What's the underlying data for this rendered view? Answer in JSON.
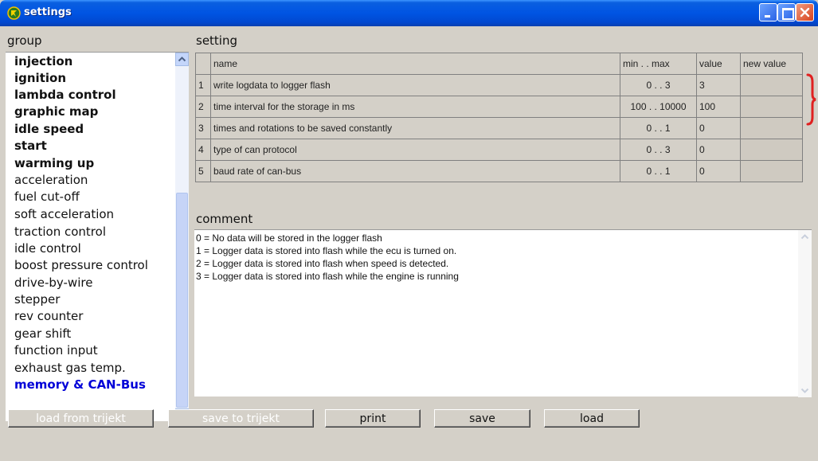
{
  "window": {
    "title": "settings"
  },
  "group": {
    "label": "group",
    "items": [
      {
        "label": "injection",
        "bold": true
      },
      {
        "label": "ignition",
        "bold": true
      },
      {
        "label": "lambda control",
        "bold": true
      },
      {
        "label": "graphic map",
        "bold": true
      },
      {
        "label": "idle speed",
        "bold": true
      },
      {
        "label": "start",
        "bold": true
      },
      {
        "label": "warming up",
        "bold": true
      },
      {
        "label": "acceleration",
        "bold": false
      },
      {
        "label": "fuel cut-off",
        "bold": false
      },
      {
        "label": "soft acceleration",
        "bold": false
      },
      {
        "label": "traction control",
        "bold": false
      },
      {
        "label": "idle control",
        "bold": false
      },
      {
        "label": "boost pressure control",
        "bold": false
      },
      {
        "label": "drive-by-wire",
        "bold": false
      },
      {
        "label": "stepper",
        "bold": false
      },
      {
        "label": "rev counter",
        "bold": false
      },
      {
        "label": "gear shift",
        "bold": false
      },
      {
        "label": "function input",
        "bold": false
      },
      {
        "label": "exhaust gas temp.",
        "bold": false
      },
      {
        "label": "memory & CAN-Bus",
        "bold": true,
        "selected": true
      }
    ]
  },
  "setting": {
    "label": "setting",
    "columns": {
      "name": "name",
      "range": "min . . max",
      "value": "value",
      "new_value": "new value"
    },
    "rows": [
      {
        "index": "1",
        "name": "write logdata to logger flash",
        "range": "0 . .   3",
        "value": "3",
        "new_value": ""
      },
      {
        "index": "2",
        "name": "time interval for the storage in ms",
        "range": "100 . . 10000",
        "value": "100",
        "new_value": ""
      },
      {
        "index": "3",
        "name": "times and rotations to be saved constantly",
        "range": "0 . .   1",
        "value": "0",
        "new_value": ""
      },
      {
        "index": "4",
        "name": "type of can protocol",
        "range": "0 . .   3",
        "value": "0",
        "new_value": ""
      },
      {
        "index": "5",
        "name": "baud rate of can-bus",
        "range": "0 . .   1",
        "value": "0",
        "new_value": ""
      }
    ]
  },
  "comment": {
    "label": "comment",
    "lines": [
      "0 = No data will be stored in the logger flash",
      "1 = Logger data is stored into flash while the ecu is turned on.",
      "2 = Logger data is stored into flash when speed is detected.",
      "3 = Logger data is stored into flash while the engine is running"
    ]
  },
  "buttons": {
    "load_from_trijekt": "load from trijekt",
    "save_to_trijekt": "save to trijekt",
    "print": "print",
    "save": "save",
    "load": "load"
  },
  "colors": {
    "titlebar": "#0054e3",
    "background": "#d4d0c8",
    "selected_item": "#0000d8",
    "annotation": "#e02020"
  },
  "icons": [
    "app-icon",
    "minimize-icon",
    "maximize-icon",
    "close-icon",
    "scroll-up-arrow-icon",
    "scroll-down-arrow-icon"
  ]
}
